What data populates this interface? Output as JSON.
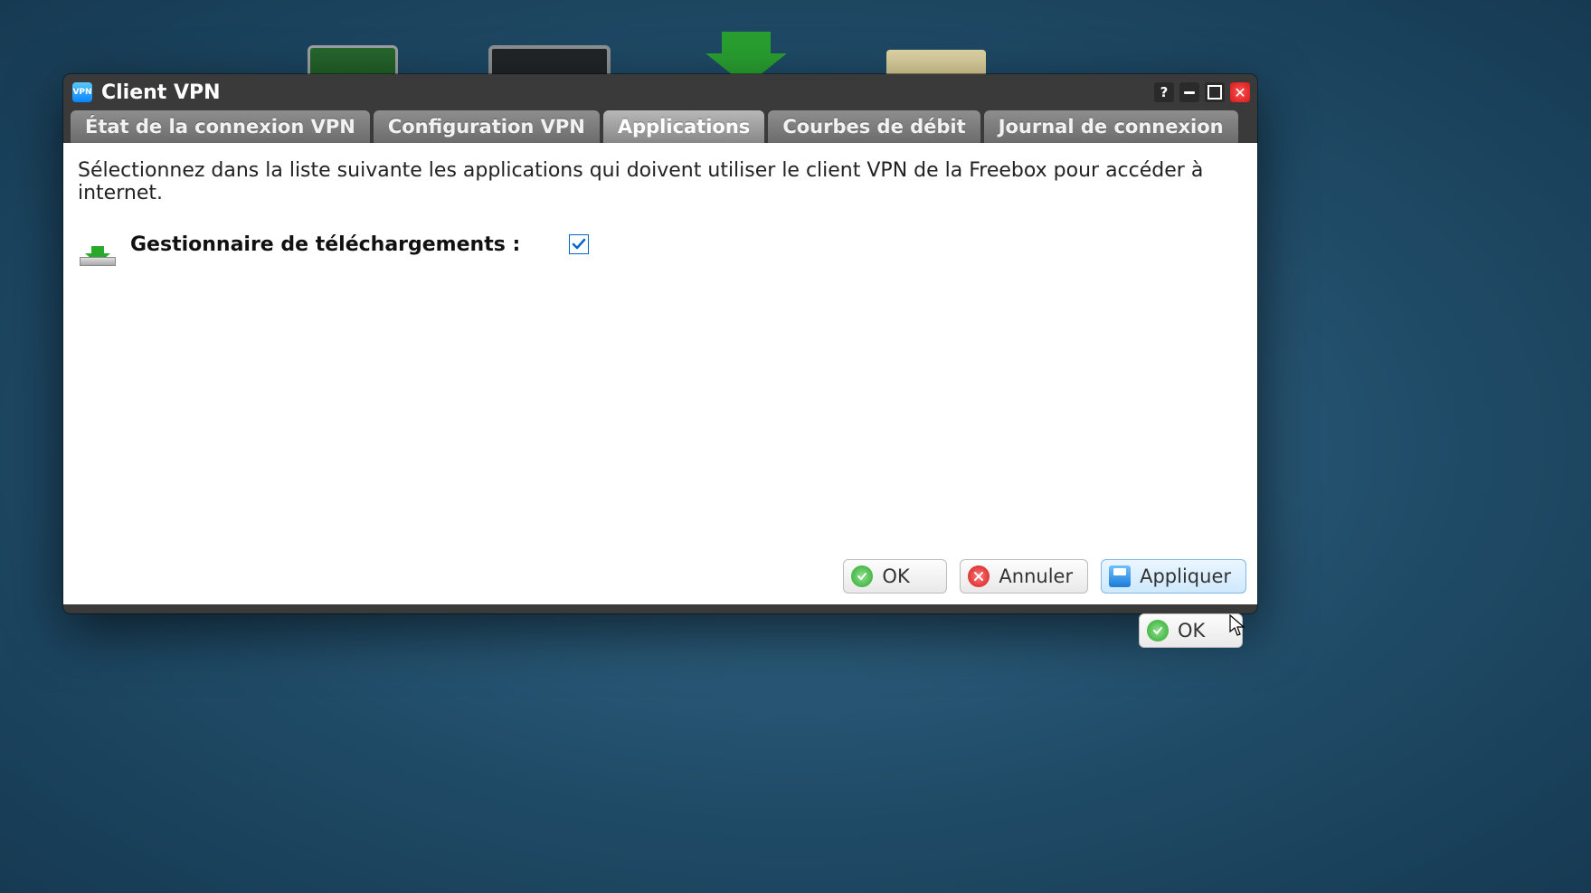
{
  "window": {
    "app_badge": "VPN",
    "title": "Client VPN"
  },
  "tabs": [
    {
      "label": "État de la connexion VPN",
      "active": false
    },
    {
      "label": "Configuration VPN",
      "active": false
    },
    {
      "label": "Applications",
      "active": true
    },
    {
      "label": "Courbes de débit",
      "active": false
    },
    {
      "label": "Journal de connexion",
      "active": false
    }
  ],
  "content": {
    "instruction": "Sélectionnez dans la liste suivante les applications qui doivent utiliser le client VPN de la Freebox pour accéder à internet.",
    "apps": [
      {
        "label": "Gestionnaire de téléchargements :",
        "checked": true
      }
    ]
  },
  "buttons": {
    "ok": "OK",
    "cancel": "Annuler",
    "apply": "Appliquer",
    "footer_ok": "OK"
  },
  "window_controls": {
    "help": "?",
    "close": "✕"
  }
}
